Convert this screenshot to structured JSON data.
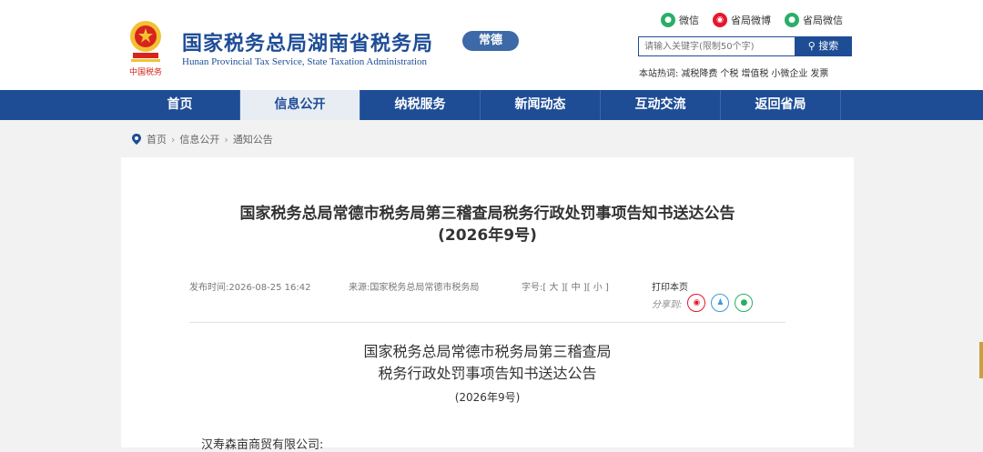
{
  "header": {
    "logo_text": "中国税务",
    "title": "国家税务总局湖南省税务局",
    "city": "常德",
    "subtitle_en": "Hunan Provincial  Tax Service,  State Taxation Administration",
    "social": [
      {
        "label": "微信",
        "icon": "wechat-icon",
        "color": "#2aae67"
      },
      {
        "label": "省局微博",
        "icon": "weibo-icon",
        "color": "#e6162d"
      },
      {
        "label": "省局微信",
        "icon": "wechat-icon",
        "color": "#2aae67"
      }
    ],
    "search": {
      "placeholder": "请输入关键字(限制50个字)",
      "button": "搜索"
    },
    "hotwords": {
      "label": "本站热词:",
      "items": [
        "减税降费",
        "个税",
        "增值税",
        "小微企业",
        "发票"
      ]
    }
  },
  "nav": {
    "items": [
      "首页",
      "信息公开",
      "纳税服务",
      "新闻动态",
      "互动交流",
      "返回省局"
    ],
    "active": 1
  },
  "breadcrumb": [
    "首页",
    "信息公开",
    "通知公告"
  ],
  "article": {
    "title_line1": "国家税务总局常德市税务局第三稽查局税务行政处罚事项告知书送达公告",
    "title_line2": "(2026年9号)",
    "publish_label": "发布时间:",
    "publish_time": "2026-08-25 16:42",
    "source_label": "来源:",
    "source": "国家税务总局常德市税务局",
    "fontsize_label": "字号:",
    "fontsize_options": [
      "[ 大 ]",
      "[ 中 ]",
      "[ 小 ]"
    ],
    "print": "打印本页",
    "share_label": "分享到:",
    "body_title_line1": "国家税务总局常德市税务局第三稽查局",
    "body_title_line2": "税务行政处罚事项告知书送达公告",
    "body_sub": "(2026年9号)",
    "addressee": "汉寿森亩商贸有限公司:"
  },
  "colors": {
    "brand": "#1e4d96",
    "background": "#f2f2f2"
  }
}
